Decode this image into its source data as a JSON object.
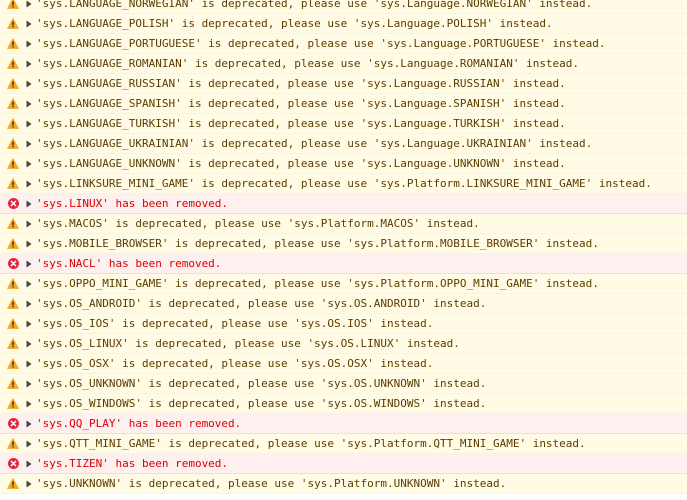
{
  "console": {
    "messages": [
      {
        "level": "warning",
        "icon": "warning-icon",
        "text": "'sys.LANGUAGE_NORWEGIAN' is deprecated, please use 'sys.Language.NORWEGIAN' instead."
      },
      {
        "level": "warning",
        "icon": "warning-icon",
        "text": "'sys.LANGUAGE_POLISH' is deprecated, please use 'sys.Language.POLISH' instead."
      },
      {
        "level": "warning",
        "icon": "warning-icon",
        "text": "'sys.LANGUAGE_PORTUGUESE' is deprecated, please use 'sys.Language.PORTUGUESE' instead."
      },
      {
        "level": "warning",
        "icon": "warning-icon",
        "text": "'sys.LANGUAGE_ROMANIAN' is deprecated, please use 'sys.Language.ROMANIAN' instead."
      },
      {
        "level": "warning",
        "icon": "warning-icon",
        "text": "'sys.LANGUAGE_RUSSIAN' is deprecated, please use 'sys.Language.RUSSIAN' instead."
      },
      {
        "level": "warning",
        "icon": "warning-icon",
        "text": "'sys.LANGUAGE_SPANISH' is deprecated, please use 'sys.Language.SPANISH' instead."
      },
      {
        "level": "warning",
        "icon": "warning-icon",
        "text": "'sys.LANGUAGE_TURKISH' is deprecated, please use 'sys.Language.TURKISH' instead."
      },
      {
        "level": "warning",
        "icon": "warning-icon",
        "text": "'sys.LANGUAGE_UKRAINIAN' is deprecated, please use 'sys.Language.UKRAINIAN' instead."
      },
      {
        "level": "warning",
        "icon": "warning-icon",
        "text": "'sys.LANGUAGE_UNKNOWN' is deprecated, please use 'sys.Language.UNKNOWN' instead."
      },
      {
        "level": "warning",
        "icon": "warning-icon",
        "text": "'sys.LINKSURE_MINI_GAME' is deprecated, please use 'sys.Platform.LINKSURE_MINI_GAME' instead."
      },
      {
        "level": "error",
        "icon": "error-icon",
        "text": "'sys.LINUX' has been removed."
      },
      {
        "level": "warning",
        "icon": "warning-icon",
        "text": "'sys.MACOS' is deprecated, please use 'sys.Platform.MACOS' instead."
      },
      {
        "level": "warning",
        "icon": "warning-icon",
        "text": "'sys.MOBILE_BROWSER' is deprecated, please use 'sys.Platform.MOBILE_BROWSER' instead."
      },
      {
        "level": "error",
        "icon": "error-icon",
        "text": "'sys.NACL' has been removed."
      },
      {
        "level": "warning",
        "icon": "warning-icon",
        "text": "'sys.OPPO_MINI_GAME' is deprecated, please use 'sys.Platform.OPPO_MINI_GAME' instead."
      },
      {
        "level": "warning",
        "icon": "warning-icon",
        "text": "'sys.OS_ANDROID' is deprecated, please use 'sys.OS.ANDROID' instead."
      },
      {
        "level": "warning",
        "icon": "warning-icon",
        "text": "'sys.OS_IOS' is deprecated, please use 'sys.OS.IOS' instead."
      },
      {
        "level": "warning",
        "icon": "warning-icon",
        "text": "'sys.OS_LINUX' is deprecated, please use 'sys.OS.LINUX' instead."
      },
      {
        "level": "warning",
        "icon": "warning-icon",
        "text": "'sys.OS_OSX' is deprecated, please use 'sys.OS.OSX' instead."
      },
      {
        "level": "warning",
        "icon": "warning-icon",
        "text": "'sys.OS_UNKNOWN' is deprecated, please use 'sys.OS.UNKNOWN' instead."
      },
      {
        "level": "warning",
        "icon": "warning-icon",
        "text": "'sys.OS_WINDOWS' is deprecated, please use 'sys.OS.WINDOWS' instead."
      },
      {
        "level": "error",
        "icon": "error-icon",
        "text": "'sys.QQ_PLAY' has been removed."
      },
      {
        "level": "warning",
        "icon": "warning-icon",
        "text": "'sys.QTT_MINI_GAME' is deprecated, please use 'sys.Platform.QTT_MINI_GAME' instead."
      },
      {
        "level": "error",
        "icon": "error-icon",
        "text": "'sys.TIZEN' has been removed."
      },
      {
        "level": "warning",
        "icon": "warning-icon",
        "text": "'sys.UNKNOWN' is deprecated, please use 'sys.Platform.UNKNOWN' instead."
      }
    ]
  },
  "colors": {
    "warning_bg": "#fffbe5",
    "warning_border": "#fff5c2",
    "warning_text": "#5c3c00",
    "warning_icon": "#f2ab26",
    "error_bg": "#fff0f0",
    "error_border": "#ffd6d6",
    "error_text": "#d80000",
    "error_icon": "#e0283c",
    "arrow": "#444444"
  }
}
